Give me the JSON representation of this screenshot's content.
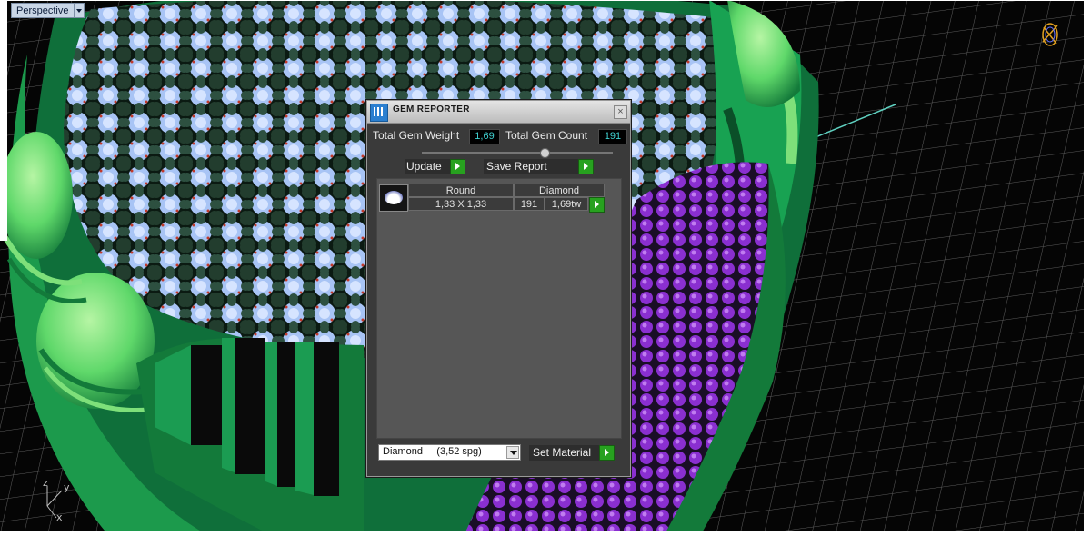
{
  "viewport": {
    "label": "Perspective",
    "axes": {
      "x": "x",
      "y": "y",
      "z": "z"
    }
  },
  "gem_reporter": {
    "title": "GEM REPORTER",
    "close_symbol": "×",
    "total_weight_label": "Total Gem Weight",
    "total_weight_value": "1,69",
    "total_count_label": "Total Gem Count",
    "total_count_value": "191",
    "slider_position": 0.65,
    "update_label": "Update",
    "save_report_label": "Save Report",
    "table": {
      "headers": [
        "Round",
        "Diamond"
      ],
      "rows": [
        {
          "size": "1,33 X 1,33",
          "count": "191",
          "weight": "1,69tw"
        }
      ]
    },
    "material_select_value": "Diamond     (3,52 spg)",
    "set_material_label": "Set Material"
  },
  "colors": {
    "ring_green": "#0f7a3e",
    "light_green": "#7ee07a",
    "prong_dark": "#1d3a2c",
    "stone_light": "#9bb6f0",
    "accent_purple": "#8a2fd0",
    "value_cyan": "#3fd0d0",
    "button_green": "#27a11f"
  }
}
